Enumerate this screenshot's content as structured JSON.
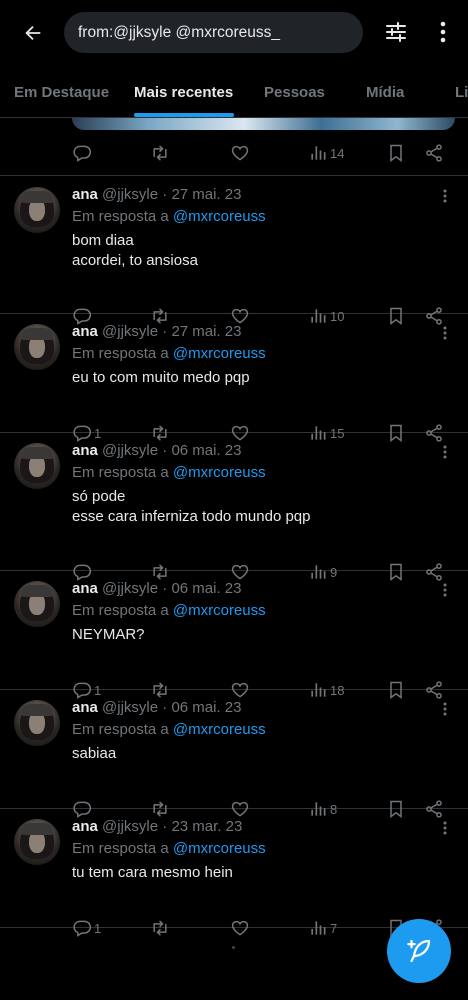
{
  "header": {
    "search_query": "from:@jjksyle @mxrcoreuss_"
  },
  "tabs": [
    {
      "label": "Em Destaque"
    },
    {
      "label": "Mais recentes"
    },
    {
      "label": "Pessoas"
    },
    {
      "label": "Mídia"
    },
    {
      "label": "Li"
    }
  ],
  "colors": {
    "accent": "#1d9bf0",
    "background": "#000000",
    "muted": "#71767b",
    "text": "#e7e9ea"
  },
  "partial_tweet": {
    "views": "14"
  },
  "tweets": [
    {
      "name": "ana",
      "handle": "@jjksyle",
      "date": "· 27 mai. 23",
      "reply_prefix": "Em resposta a",
      "reply_handle": "@mxrcoreuss",
      "lines": [
        "bom diaa",
        "acordei, to ansiosa"
      ],
      "replies": "",
      "views": "10"
    },
    {
      "name": "ana",
      "handle": "@jjksyle",
      "date": "· 27 mai. 23",
      "reply_prefix": "Em resposta a",
      "reply_handle": "@mxrcoreuss",
      "lines": [
        "eu to com muito medo pqp"
      ],
      "replies": "1",
      "views": "15"
    },
    {
      "name": "ana",
      "handle": "@jjksyle",
      "date": "· 06 mai. 23",
      "reply_prefix": "Em resposta a",
      "reply_handle": "@mxrcoreuss",
      "lines": [
        "só pode",
        "esse cara inferniza todo mundo pqp"
      ],
      "replies": "",
      "views": "9"
    },
    {
      "name": "ana",
      "handle": "@jjksyle",
      "date": "· 06 mai. 23",
      "reply_prefix": "Em resposta a",
      "reply_handle": "@mxrcoreuss",
      "lines": [
        "NEYMAR?"
      ],
      "replies": "1",
      "views": "18"
    },
    {
      "name": "ana",
      "handle": "@jjksyle",
      "date": "· 06 mai. 23",
      "reply_prefix": "Em resposta a",
      "reply_handle": "@mxrcoreuss",
      "lines": [
        "sabiaa"
      ],
      "replies": "",
      "views": "8"
    },
    {
      "name": "ana",
      "handle": "@jjksyle",
      "date": "· 23 mar. 23",
      "reply_prefix": "Em resposta a",
      "reply_handle": "@mxrcoreuss",
      "lines": [
        "tu tem cara mesmo hein"
      ],
      "replies": "1",
      "views": "7"
    }
  ],
  "icons": {
    "back": "arrow-left-icon",
    "filter": "sliders-icon",
    "more": "more-vertical-icon",
    "reply": "reply-icon",
    "retweet": "retweet-icon",
    "like": "heart-icon",
    "views": "views-icon",
    "bookmark": "bookmark-icon",
    "share": "share-icon",
    "compose": "compose-icon"
  }
}
